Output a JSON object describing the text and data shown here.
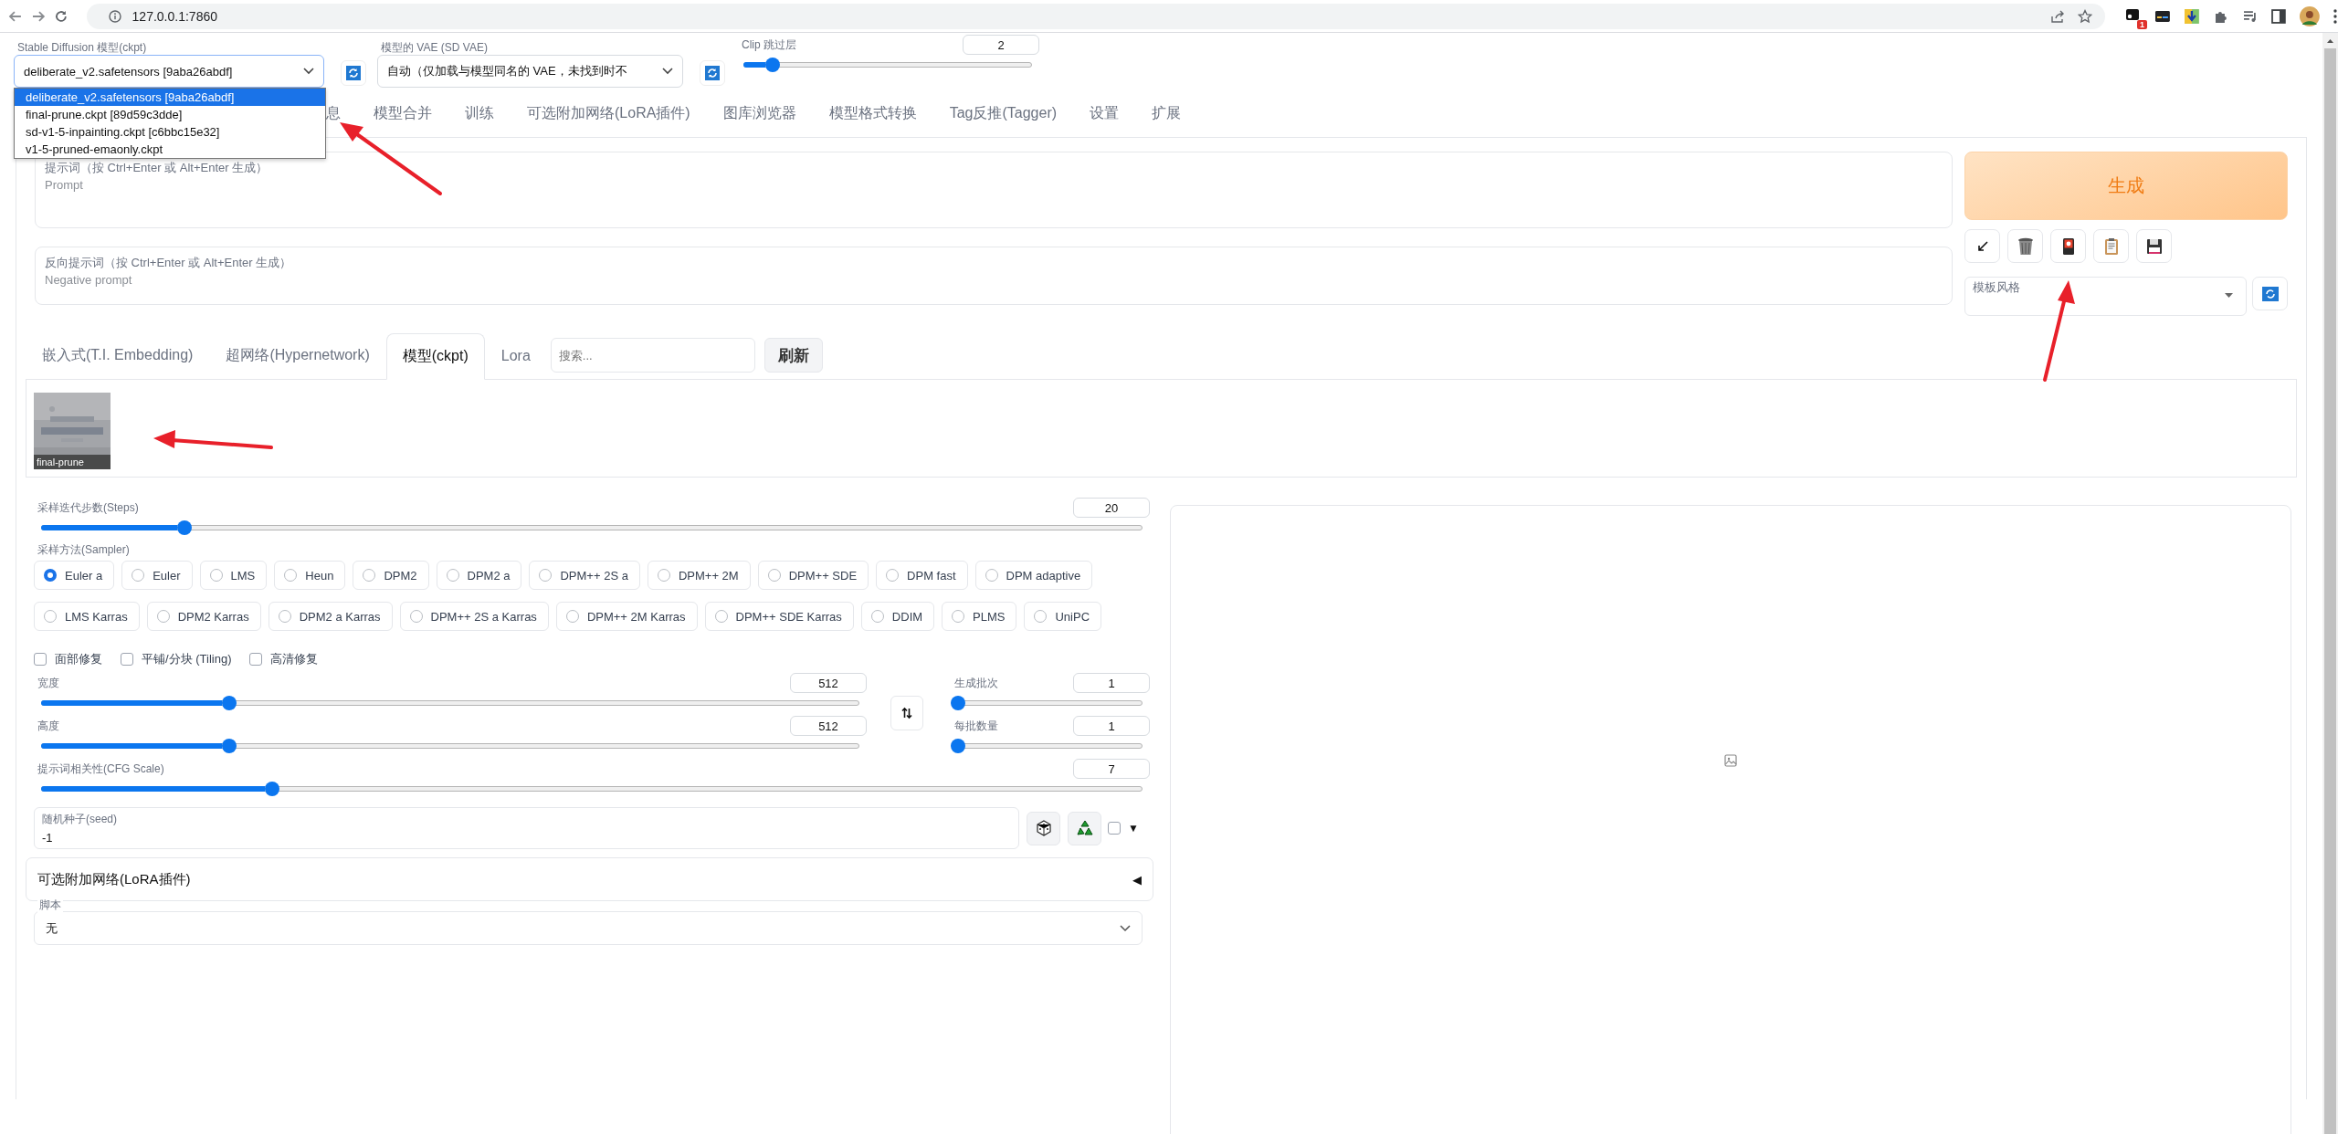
{
  "browser": {
    "url": "127.0.0.1:7860",
    "extension_badge": "1"
  },
  "settings": {
    "checkpoint": {
      "label": "Stable Diffusion 模型(ckpt)",
      "value": "deliberate_v2.safetensors [9aba26abdf]",
      "expanded": true,
      "options": [
        {
          "text": "deliberate_v2.safetensors [9aba26abdf]",
          "selected": true
        },
        {
          "text": "final-prune.ckpt [89d59c3dde]",
          "selected": false
        },
        {
          "text": "sd-v1-5-inpainting.ckpt [c6bbc15e32]",
          "selected": false
        },
        {
          "text": "v1-5-pruned-emaonly.ckpt",
          "selected": false
        }
      ]
    },
    "vae": {
      "label": "模型的 VAE (SD VAE)",
      "value": "自动（仅加载与模型同名的 VAE，未找到时不"
    },
    "clip_skip": {
      "label": "Clip 跳过层",
      "value": "2",
      "level": 0.1
    }
  },
  "tabs": [
    {
      "label": "息",
      "selected": false
    },
    {
      "label": "模型合并",
      "selected": false
    },
    {
      "label": "训练",
      "selected": false
    },
    {
      "label": "可选附加网络(LoRA插件)",
      "selected": false
    },
    {
      "label": "图库浏览器",
      "selected": false
    },
    {
      "label": "模型格式转换",
      "selected": false
    },
    {
      "label": "Tag反推(Tagger)",
      "selected": false
    },
    {
      "label": "设置",
      "selected": false
    },
    {
      "label": "扩展",
      "selected": false
    }
  ],
  "prompt": {
    "label": "提示词（按 Ctrl+Enter 或 Alt+Enter 生成）",
    "placeholder": "Prompt"
  },
  "negative_prompt": {
    "label": "反向提示词（按 Ctrl+Enter 或 Alt+Enter 生成）",
    "placeholder": "Negative prompt"
  },
  "generate_button": "生成",
  "styles": {
    "label": "模板风格"
  },
  "extra_networks": {
    "tabs": [
      {
        "label": "嵌入式(T.I. Embedding)",
        "selected": false
      },
      {
        "label": "超网络(Hypernetwork)",
        "selected": false
      },
      {
        "label": "模型(ckpt)",
        "selected": true
      },
      {
        "label": "Lora",
        "selected": false
      }
    ],
    "search_placeholder": "搜索...",
    "refresh_button": "刷新",
    "cards": [
      {
        "name": "final-prune",
        "kind": "picture"
      }
    ]
  },
  "steps": {
    "label": "采样迭代步数(Steps)",
    "value": "20",
    "level": 0.13
  },
  "sampler": {
    "label": "采样方法(Sampler)",
    "options": [
      {
        "label": "Euler a",
        "selected": true
      },
      {
        "label": "Euler",
        "selected": false
      },
      {
        "label": "LMS",
        "selected": false
      },
      {
        "label": "Heun",
        "selected": false
      },
      {
        "label": "DPM2",
        "selected": false
      },
      {
        "label": "DPM2 a",
        "selected": false
      },
      {
        "label": "DPM++ 2S a",
        "selected": false
      },
      {
        "label": "DPM++ 2M",
        "selected": false
      },
      {
        "label": "DPM++ SDE",
        "selected": false
      },
      {
        "label": "DPM fast",
        "selected": false
      },
      {
        "label": "DPM adaptive",
        "selected": false
      },
      {
        "label": "LMS Karras",
        "selected": false
      },
      {
        "label": "DPM2 Karras",
        "selected": false
      },
      {
        "label": "DPM2 a Karras",
        "selected": false
      },
      {
        "label": "DPM++ 2S a Karras",
        "selected": false
      },
      {
        "label": "DPM++ 2M Karras",
        "selected": false
      },
      {
        "label": "DPM++ SDE Karras",
        "selected": false
      },
      {
        "label": "DDIM",
        "selected": false
      },
      {
        "label": "PLMS",
        "selected": false
      },
      {
        "label": "UniPC",
        "selected": false
      }
    ]
  },
  "checkboxes": [
    {
      "label": "面部修复",
      "checked": false
    },
    {
      "label": "平铺/分块 (Tiling)",
      "checked": false
    },
    {
      "label": "高清修复",
      "checked": false
    }
  ],
  "width": {
    "label": "宽度",
    "value": "512",
    "level": 0.23
  },
  "height": {
    "label": "高度",
    "value": "512",
    "level": 0.23
  },
  "batch_count": {
    "label": "生成批次",
    "value": "1",
    "level": 0
  },
  "batch_size": {
    "label": "每批数量",
    "value": "1",
    "level": 0
  },
  "cfg_scale": {
    "label": "提示词相关性(CFG Scale)",
    "value": "7",
    "level": 0.21
  },
  "seed": {
    "label": "随机种子(seed)",
    "value": "-1",
    "extra_checked": false,
    "extra_arrow": "▼"
  },
  "accordion": {
    "title": "可选附加网络(LoRA插件)",
    "arrow": "◀"
  },
  "script": {
    "label": "脚本",
    "value": "无"
  }
}
